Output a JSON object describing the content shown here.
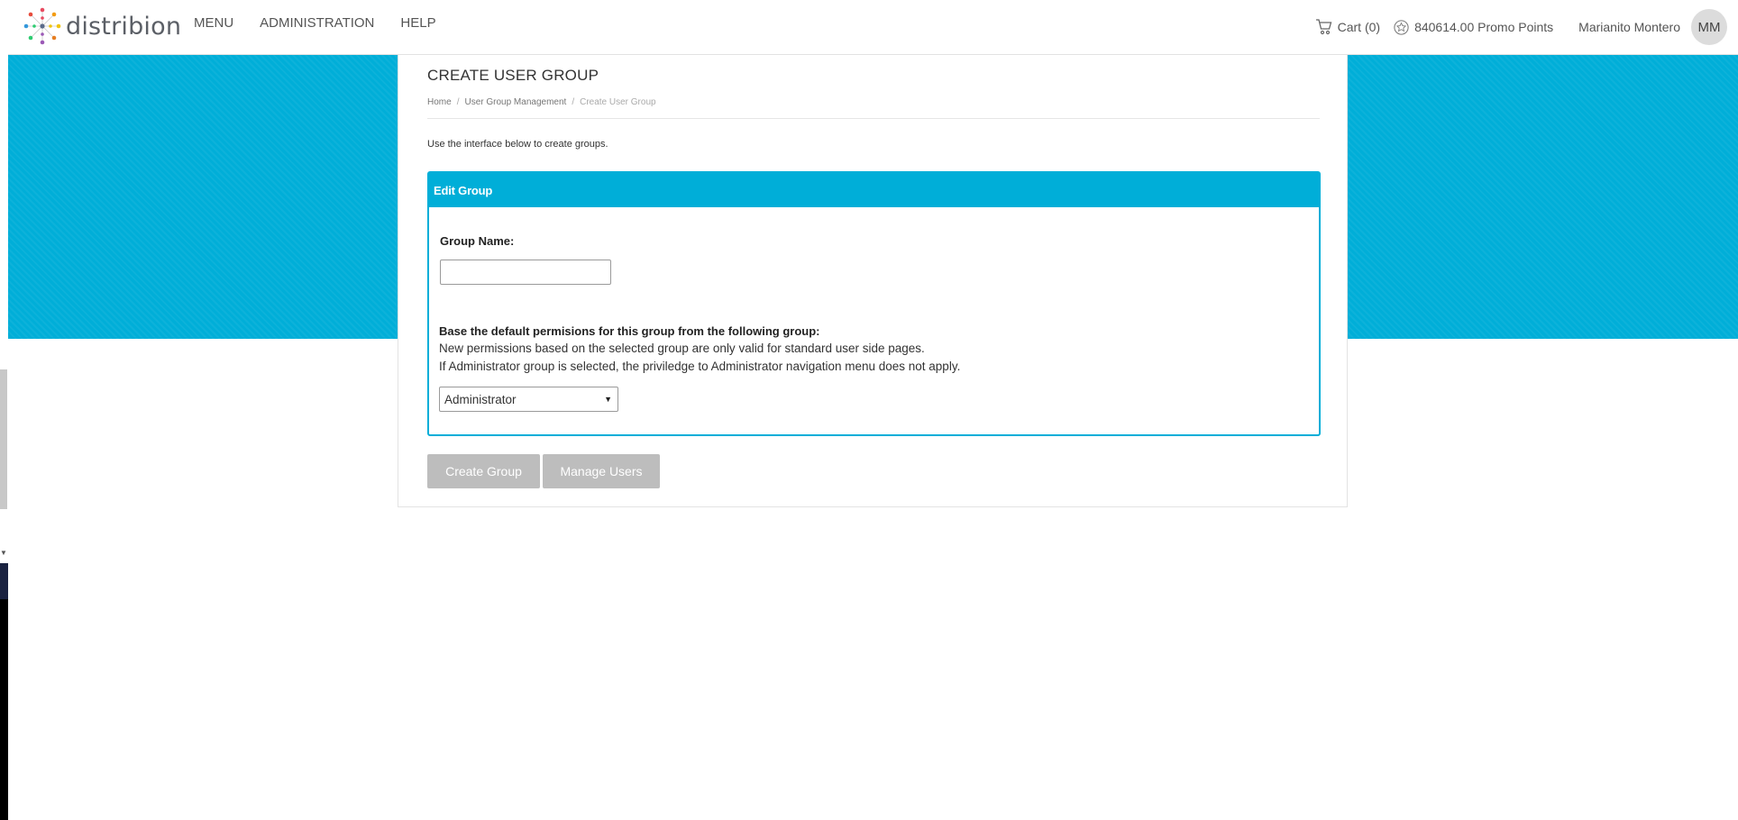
{
  "app": {
    "logo_text": "distribion",
    "nav": [
      "MENU",
      "ADMINISTRATION",
      "HELP"
    ],
    "cart_label": "Cart (0)",
    "points_label": "840614.00 Promo Points",
    "user_name": "Marianito Montero",
    "user_initials": "MM"
  },
  "page": {
    "title": "CREATE USER GROUP",
    "breadcrumb": {
      "home": "Home",
      "parent": "User Group Management",
      "current": "Create User Group"
    },
    "intro": "Use the interface below to create groups."
  },
  "panel": {
    "heading": "Edit Group",
    "group_name_label": "Group Name:",
    "group_name_value": "",
    "permissions_label": "Base the default permisions for this group from the following group:",
    "note_1": "New permissions based on the selected group are only valid for standard user side pages.",
    "note_2": "If Administrator group is selected, the priviledge to Administrator navigation menu does not apply.",
    "selected_group": "Administrator"
  },
  "actions": {
    "create_label": "Create Group",
    "manage_label": "Manage Users"
  },
  "colors": {
    "accent": "#00aed8",
    "button_disabled": "#bdbdbd"
  }
}
